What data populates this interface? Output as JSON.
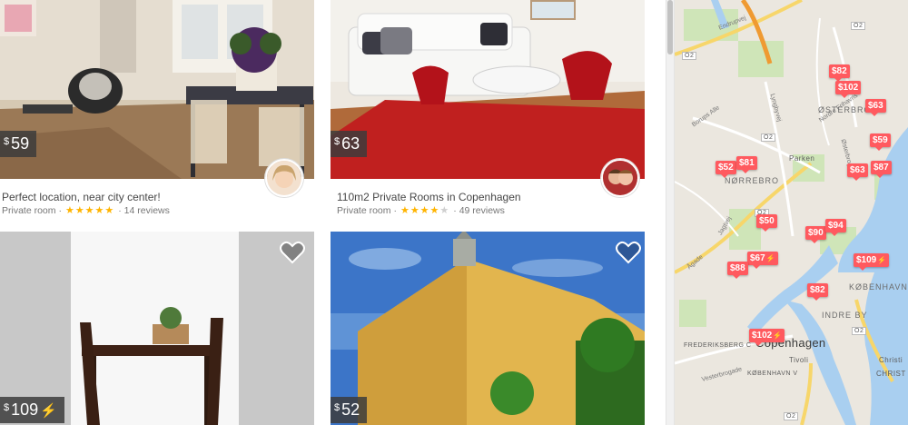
{
  "currency_symbol": "$",
  "listings": [
    {
      "price": "59",
      "title": "Perfect location, near city center!",
      "room_type": "Private room",
      "stars": "★★★★★",
      "stars_off": "",
      "reviews": "· 14 reviews",
      "instant_book": false
    },
    {
      "price": "63",
      "title": "110m2 Private Rooms in Copenhagen",
      "room_type": "Private room",
      "stars": "★★★★",
      "stars_off": "★",
      "reviews": "· 49 reviews",
      "instant_book": false
    },
    {
      "price": "109",
      "instant_book": true,
      "bolt": "⚡"
    },
    {
      "price": "52",
      "instant_book": false
    }
  ],
  "map": {
    "pins": [
      {
        "label": "$82"
      },
      {
        "label": "$102"
      },
      {
        "label": "$63"
      },
      {
        "label": "$59"
      },
      {
        "label": "$52"
      },
      {
        "label": "$81"
      },
      {
        "label": "$63"
      },
      {
        "label": "$87"
      },
      {
        "label": "$50"
      },
      {
        "label": "$90"
      },
      {
        "label": "$94"
      },
      {
        "label": "$67",
        "bolt": "⚡"
      },
      {
        "label": "$109",
        "bolt": "⚡"
      },
      {
        "label": "$88"
      },
      {
        "label": "$82"
      },
      {
        "label": "$102",
        "bolt": "⚡"
      }
    ],
    "labels": {
      "osterbro": "ØSTERBRO",
      "norrebro": "NØRREBRO",
      "parken": "Parken",
      "kobenhavn_k": "KØBENHAVN K",
      "indre_by": "INDRE BY",
      "copenhagen": "Copenhagen",
      "frederiksberg": "FREDERIKSBERG C",
      "kobenhavn_v": "KØBENHAVN V",
      "tivoli": "Tivoli",
      "christi": "Christi",
      "christ": "CHRIST"
    },
    "streets": {
      "endrupvej": "Endrupvej",
      "lyngbyvej": "Lyngbyvej",
      "borups": "Borups Alle",
      "jagtvej": "Jagtvej",
      "agade": "Ågade",
      "vesterbro": "Vesterbrogade",
      "osterbrogade": "Østerbrogade",
      "strandboul": "Strandboulevarden",
      "nordre": "Nordre Frihavns"
    },
    "route_badges": [
      "O2",
      "O2",
      "O2",
      "O2",
      "O2",
      "O2"
    ]
  }
}
